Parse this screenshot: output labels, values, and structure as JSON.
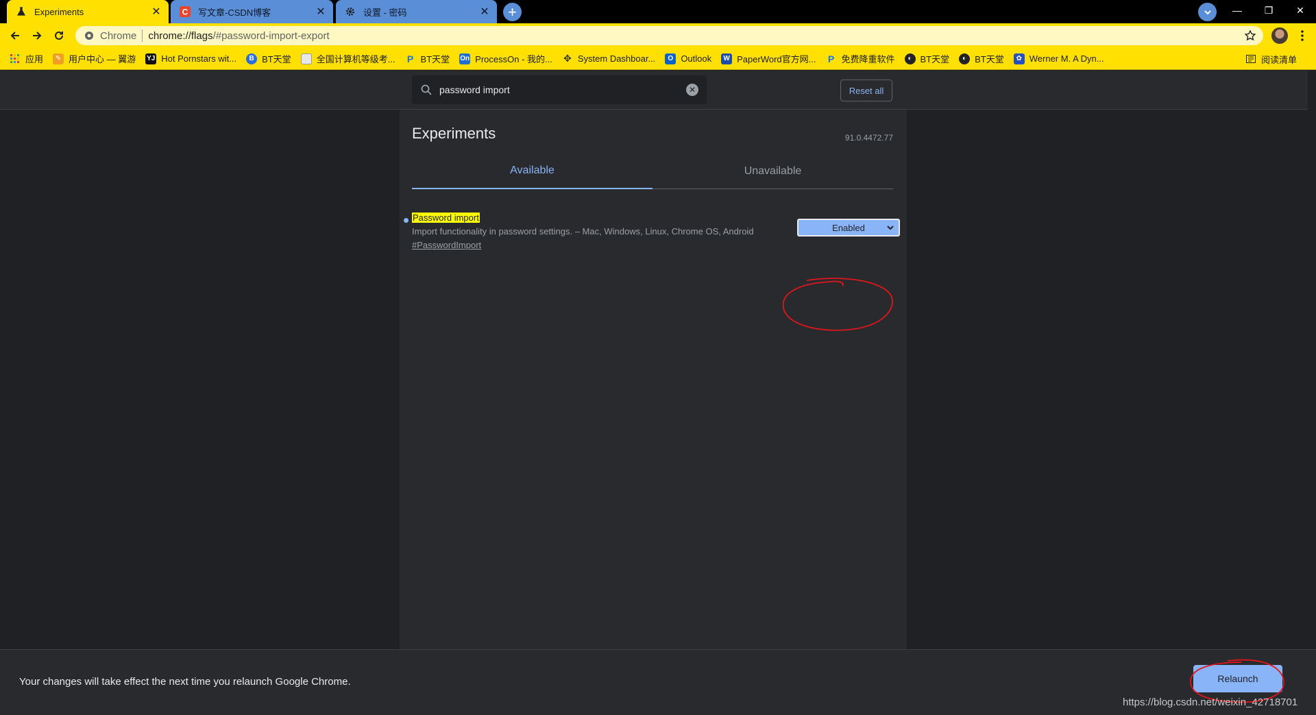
{
  "tabs": [
    {
      "title": "Experiments",
      "icon": "flask-icon"
    },
    {
      "title": "写文章-CSDN博客",
      "icon": "csdn-icon"
    },
    {
      "title": "设置 - 密码",
      "icon": "gear-icon"
    }
  ],
  "omnibox": {
    "chip": "Chrome",
    "url_host": "chrome://flags",
    "url_path": "/#password-import-export"
  },
  "bookmarks": [
    {
      "label": "应用",
      "icon": "apps-grid-icon",
      "color": "#4285f4"
    },
    {
      "label": "用户中心 — 翼游",
      "icon": "bookmark-icon",
      "color": "#f0a020"
    },
    {
      "label": "Hot Pornstars wit...",
      "icon": "yj-icon",
      "color": "#111111"
    },
    {
      "label": "BT天堂",
      "icon": "bt-icon",
      "color": "#2a6fdb"
    },
    {
      "label": "全国计算机等级考...",
      "icon": "page-icon",
      "color": "#e8e8e8"
    },
    {
      "label": "BT天堂",
      "icon": "bt-p-icon",
      "color": "#1a73e8"
    },
    {
      "label": "ProcessOn - 我的...",
      "icon": "processon-icon",
      "color": "#1f6fd1"
    },
    {
      "label": "System Dashboar...",
      "icon": "system-icon",
      "color": "#333333"
    },
    {
      "label": "Outlook",
      "icon": "outlook-icon",
      "color": "#0a64c8"
    },
    {
      "label": "PaperWord官方网...",
      "icon": "paperword-icon",
      "color": "#1a4ea8"
    },
    {
      "label": "免费降重软件",
      "icon": "p-icon",
      "color": "#1a73e8"
    },
    {
      "label": "BT天堂",
      "icon": "bt-globe-icon",
      "color": "#222222"
    },
    {
      "label": "BT天堂",
      "icon": "bt-globe-icon",
      "color": "#222222"
    },
    {
      "label": "Werner M. A Dyn...",
      "icon": "paw-icon",
      "color": "#2450c0"
    }
  ],
  "reading_list": "阅读清单",
  "search": {
    "value": "password import"
  },
  "reset_label": "Reset all",
  "page_title": "Experiments",
  "version": "91.0.4472.77",
  "flag_tabs": {
    "available": "Available",
    "unavailable": "Unavailable"
  },
  "flag": {
    "name": "Password import",
    "description": "Import functionality in password settings. – Mac, Windows, Linux, Chrome OS, Android",
    "id": "#PasswordImport",
    "value": "Enabled"
  },
  "footer": {
    "message": "Your changes will take effect the next time you relaunch Google Chrome.",
    "relaunch_label": "Relaunch"
  },
  "watermark": "https://blog.csdn.net/weixin_42718701",
  "colors": {
    "toolbar": "#ffe000",
    "inactive_tab": "#5a8fd8",
    "accent": "#8ab4f8",
    "annotation": "#e0161c"
  }
}
